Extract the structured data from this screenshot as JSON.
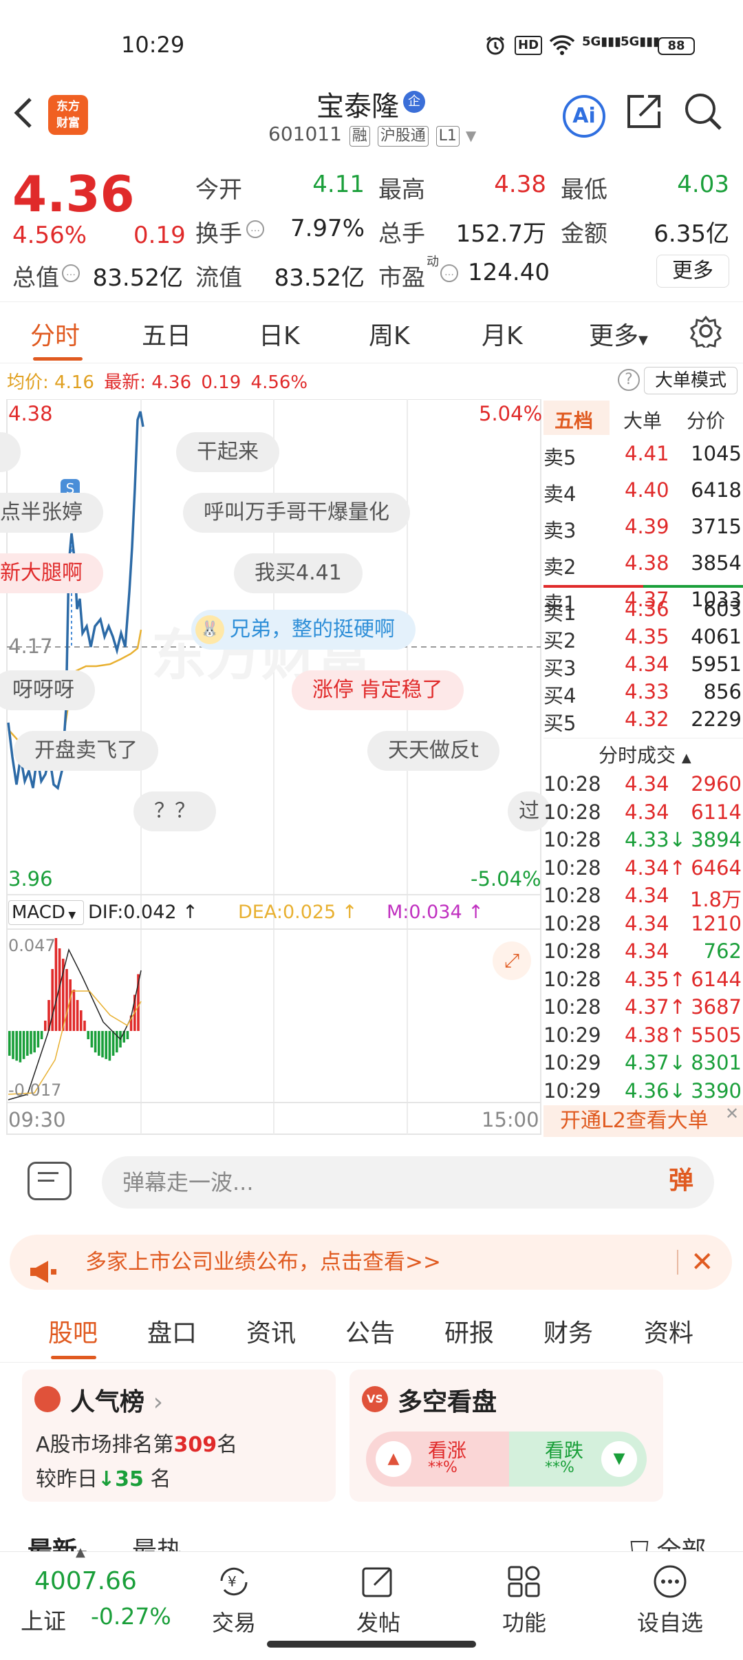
{
  "status": {
    "time": "10:29",
    "net1": "5G",
    "net2": "5G",
    "hd": "HD",
    "battery": "88"
  },
  "header": {
    "logo_line1": "东方",
    "logo_line2": "财富",
    "stock_name": "宝泰隆",
    "badge": "企",
    "code": "601011",
    "tags": [
      "融",
      "沪股通",
      "L1"
    ],
    "ai_label": "Ai"
  },
  "quote": {
    "price": "4.36",
    "change_pct": "4.56%",
    "change": "0.19",
    "fields": [
      {
        "label": "今开",
        "value": "4.11",
        "color": "green"
      },
      {
        "label": "最高",
        "value": "4.38",
        "color": "red"
      },
      {
        "label": "最低",
        "value": "4.03",
        "color": "green"
      },
      {
        "label": "换手",
        "value": "7.97%",
        "color": "black"
      },
      {
        "label": "总手",
        "value": "152.7万",
        "color": "black"
      },
      {
        "label": "金额",
        "value": "6.35亿",
        "color": "black"
      },
      {
        "label": "总值",
        "value": "83.52亿",
        "color": "black"
      },
      {
        "label": "流值",
        "value": "83.52亿",
        "color": "black"
      },
      {
        "label": "市盈",
        "value": "124.40",
        "color": "black"
      }
    ],
    "pe_sup": "动",
    "more": "更多"
  },
  "tabs": [
    "分时",
    "五日",
    "日K",
    "周K",
    "月K",
    "更多"
  ],
  "avg_bar": {
    "avg_label": "均价:",
    "avg_value": "4.16",
    "latest_label": "最新:",
    "latest": "4.36",
    "change": "0.19",
    "pct": "4.56%",
    "big_order": "大单模式"
  },
  "chart": {
    "y_top": "4.38",
    "y_top_pct": "5.04%",
    "y_mid": "4.17",
    "y_bottom": "3.96",
    "y_bottom_pct": "-5.04%",
    "s_badge": "S",
    "macd_label": "MACD",
    "dif": "DIF:0.042",
    "dea": "DEA:0.025",
    "m": "M:0.034",
    "macd_top": "0.047",
    "macd_bottom": "-0.017",
    "t_start": "09:30",
    "t_end": "15:00",
    "watermark": "东方财富"
  },
  "danmu": [
    "干起来",
    "点半张婷",
    "呼叫万手哥干爆量化",
    "新大腿啊",
    "我买4.41",
    "兄弟，整的挺硬啊",
    "涨停 肯定稳了",
    "呀呀呀",
    "开盘卖飞了",
    "天天做反t",
    "？？",
    "过"
  ],
  "book": {
    "tabs": [
      "五档",
      "大单",
      "分价"
    ],
    "asks": [
      {
        "label": "卖5",
        "price": "4.41",
        "vol": "1045"
      },
      {
        "label": "卖4",
        "price": "4.40",
        "vol": "6418"
      },
      {
        "label": "卖3",
        "price": "4.39",
        "vol": "3715"
      },
      {
        "label": "卖2",
        "price": "4.38",
        "vol": "3854"
      },
      {
        "label": "卖1",
        "price": "4.37",
        "vol": "1033"
      }
    ],
    "bids": [
      {
        "label": "买1",
        "price": "4.36",
        "vol": "603"
      },
      {
        "label": "买2",
        "price": "4.35",
        "vol": "4061"
      },
      {
        "label": "买3",
        "price": "4.34",
        "vol": "5951"
      },
      {
        "label": "买4",
        "price": "4.33",
        "vol": "856"
      },
      {
        "label": "买5",
        "price": "4.32",
        "vol": "2229"
      }
    ],
    "trades_title": "分时成交",
    "trades": [
      {
        "time": "10:28",
        "price": "4.34",
        "arrow": "",
        "vol": "2960",
        "vc": "red"
      },
      {
        "time": "10:28",
        "price": "4.34",
        "arrow": "",
        "vol": "6114",
        "vc": "red"
      },
      {
        "time": "10:28",
        "price": "4.33",
        "arrow": "↓",
        "vol": "3894",
        "vc": "green"
      },
      {
        "time": "10:28",
        "price": "4.34",
        "arrow": "↑",
        "vol": "6464",
        "vc": "red"
      },
      {
        "time": "10:28",
        "price": "4.34",
        "arrow": "",
        "vol": "1.8万",
        "vc": "red"
      },
      {
        "time": "10:28",
        "price": "4.34",
        "arrow": "",
        "vol": "1210",
        "vc": "red"
      },
      {
        "time": "10:28",
        "price": "4.34",
        "arrow": "",
        "vol": "762",
        "vc": "green"
      },
      {
        "time": "10:28",
        "price": "4.35",
        "arrow": "↑",
        "vol": "6144",
        "vc": "red"
      },
      {
        "time": "10:28",
        "price": "4.37",
        "arrow": "↑",
        "vol": "3687",
        "vc": "red"
      },
      {
        "time": "10:29",
        "price": "4.38",
        "arrow": "↑",
        "vol": "5505",
        "vc": "red"
      },
      {
        "time": "10:29",
        "price": "4.37",
        "arrow": "↓",
        "vol": "8301",
        "vc": "green"
      },
      {
        "time": "10:29",
        "price": "4.36",
        "arrow": "↓",
        "vol": "3390",
        "vc": "green"
      }
    ],
    "l2_banner": "开通L2查看大单"
  },
  "danmu_input": {
    "placeholder": "弹幕走一波...",
    "btn": "弹"
  },
  "notice": {
    "text": "多家上市公司业绩公布，点击查看>>"
  },
  "subtabs": [
    "股吧",
    "盘口",
    "资讯",
    "公告",
    "研报",
    "财务",
    "资料"
  ],
  "popularity": {
    "title": "人气榜",
    "line1_pre": "A股市场排名第",
    "rank": "309",
    "line1_post": "名",
    "line2_pre": "较昨日",
    "delta": "35",
    "line2_post": "名"
  },
  "longshort": {
    "title": "多空看盘",
    "up": "看涨",
    "down": "看跌",
    "up_pct": "**%",
    "down_pct": "**%"
  },
  "feed_tabs": {
    "latest": "最新",
    "hot": "最热",
    "all": "全部"
  },
  "bottom": {
    "index_value": "4007.66",
    "index_name": "上证",
    "index_pct": "-0.27%",
    "items": [
      "交易",
      "发帖",
      "功能",
      "设自选"
    ]
  }
}
